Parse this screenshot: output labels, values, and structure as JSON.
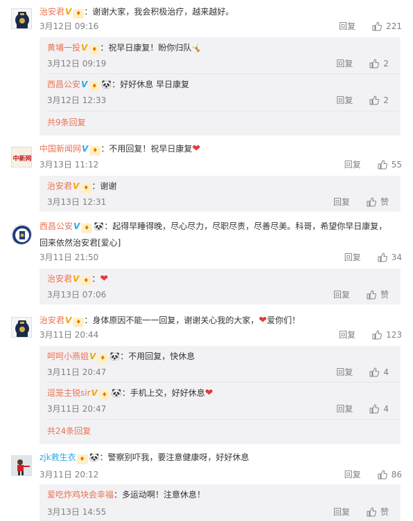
{
  "comments": [
    {
      "user": "治安君",
      "verified": "v-yellow",
      "text": "：谢谢大家，我会积极治疗，越来越好。",
      "time": "3月12日 09:16",
      "reply_label": "回复",
      "likes": "221",
      "avatar": "police-badge-icon",
      "replies": [
        {
          "user": "黄埔一投",
          "text": "：祝早日康复！盼你归队",
          "emoji": "🤸",
          "time": "3月12日 09:19",
          "reply_label": "回复",
          "likes": "2"
        },
        {
          "user": "西昌公安",
          "blue": true,
          "text": "：好好休息 早日康复",
          "time": "3月12日 12:33",
          "reply_label": "回复",
          "likes": "2"
        }
      ],
      "more": "共9条回复"
    },
    {
      "user": "中国新闻网",
      "text": "：不用回复！祝早日康复",
      "time": "3月13日 11:12",
      "reply_label": "回复",
      "likes": "55",
      "avatar": "chinanews-logo-icon",
      "replies": [
        {
          "user": "治安君",
          "text": "：谢谢",
          "time": "3月13日 12:31",
          "reply_label": "回复",
          "likes": "赞"
        }
      ]
    },
    {
      "user": "西昌公安",
      "text": "：起得早睡得晚，尽心尽力，尽职尽责，尽善尽美。科哥，希望你早日康复，",
      "text2": "回来依然治安君[爱心]",
      "time": "3月11日 21:50",
      "reply_label": "回复",
      "likes": "34",
      "avatar": "police-emblem-icon",
      "replies": [
        {
          "user": "治安君",
          "text": "：",
          "time": "3月13日 07:06",
          "reply_label": "回复",
          "likes": "赞"
        }
      ]
    },
    {
      "user": "治安君",
      "text": "：身体原因不能一一回复，谢谢关心我的大家，",
      "text_after": "爱你们！",
      "time": "3月11日 20:44",
      "reply_label": "回复",
      "likes": "123",
      "avatar": "police-badge-icon",
      "replies": [
        {
          "user": "呵呵小燕姐",
          "text": "：不用回复，快休息",
          "time": "3月11日 20:47",
          "reply_label": "回复",
          "likes": "4"
        },
        {
          "user": "逗笼主锐sir",
          "text": "：手机上交，好好休息",
          "time": "3月11日 20:47",
          "reply_label": "回复",
          "likes": "4"
        }
      ],
      "more": "共24条回复"
    },
    {
      "user": "zjk救生衣",
      "text": "：警察别吓我，要注意健康呀，好好休息",
      "time": "3月11日 20:12",
      "reply_label": "回复",
      "likes": "86",
      "avatar": "athlete-photo-icon",
      "replies": [
        {
          "user": "爱吃炸鸡块会幸福",
          "text": "：多运动啊！注意休息！",
          "time": "3月13日 14:55",
          "reply_label": "回复",
          "likes": "赞"
        }
      ]
    }
  ],
  "colors": {
    "username": "#eb7350",
    "verified_yellow": "#f7a700",
    "verified_blue": "#2ba8e4",
    "reply_bg": "#f2f2f5",
    "meta": "#808080"
  }
}
